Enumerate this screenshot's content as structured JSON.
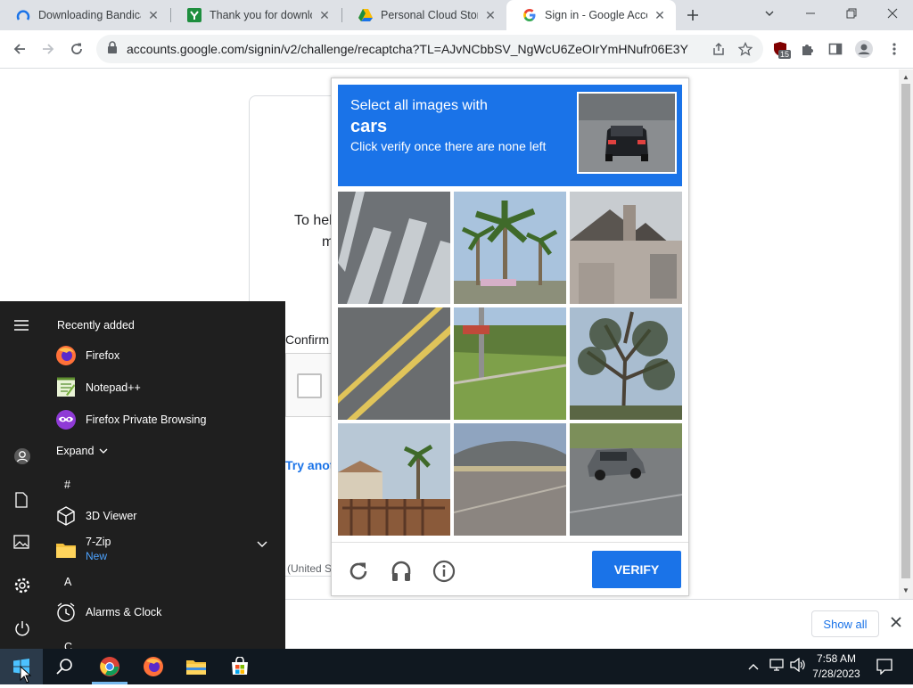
{
  "browser": {
    "tabs": [
      {
        "title": "Downloading Bandicam",
        "favicon": "bandicam-icon",
        "active": false
      },
      {
        "title": "Thank you for downloading",
        "favicon": "download-site-icon",
        "active": false
      },
      {
        "title": "Personal Cloud Storage",
        "favicon": "google-drive-icon",
        "active": false
      },
      {
        "title": "Sign in - Google Accounts",
        "favicon": "google-icon",
        "active": true
      }
    ],
    "url": "accounts.google.com/signin/v2/challenge/recaptcha?TL=AJvNCbbSV_NgWcU6ZeOIrYmHNufr06E3Y2...",
    "extension_badge": "15"
  },
  "page": {
    "help_text_line1": "To hel",
    "help_text_line2": "m",
    "confirm_label": "Confirm",
    "try_another_link": "Try anot",
    "language_text": "(United S"
  },
  "recaptcha": {
    "instruction": "Select all images with",
    "target": "cars",
    "subtext": "Click verify once there are none left",
    "verify_label": "VERIFY",
    "accent_color": "#1a73e8",
    "tiles": [
      {
        "depicts": "road-marking-text"
      },
      {
        "depicts": "palm-trees"
      },
      {
        "depicts": "house-roof"
      },
      {
        "depicts": "yellow-road-lines"
      },
      {
        "depicts": "grass-pole"
      },
      {
        "depicts": "tree-branches"
      },
      {
        "depicts": "building-palms"
      },
      {
        "depicts": "overpass"
      },
      {
        "depicts": "car-on-road"
      }
    ]
  },
  "start_menu": {
    "recently_added_header": "Recently added",
    "recent": [
      {
        "label": "Firefox",
        "icon": "firefox-icon"
      },
      {
        "label": "Notepad++",
        "icon": "notepadpp-icon"
      },
      {
        "label": "Firefox Private Browsing",
        "icon": "firefox-private-icon"
      }
    ],
    "expand_label": "Expand",
    "section_hash": "#",
    "apps_hash": [
      {
        "label": "3D Viewer",
        "icon": "3d-viewer-icon"
      },
      {
        "label": "7-Zip",
        "sublabel": "New",
        "icon": "folder-icon"
      }
    ],
    "section_a": "A",
    "apps_a": [
      {
        "label": "Alarms & Clock",
        "icon": "alarm-clock-icon"
      }
    ],
    "section_c": "C"
  },
  "download_bar": {
    "show_all_label": "Show all"
  },
  "taskbar": {
    "time": "7:58 AM",
    "date": "7/28/2023"
  }
}
